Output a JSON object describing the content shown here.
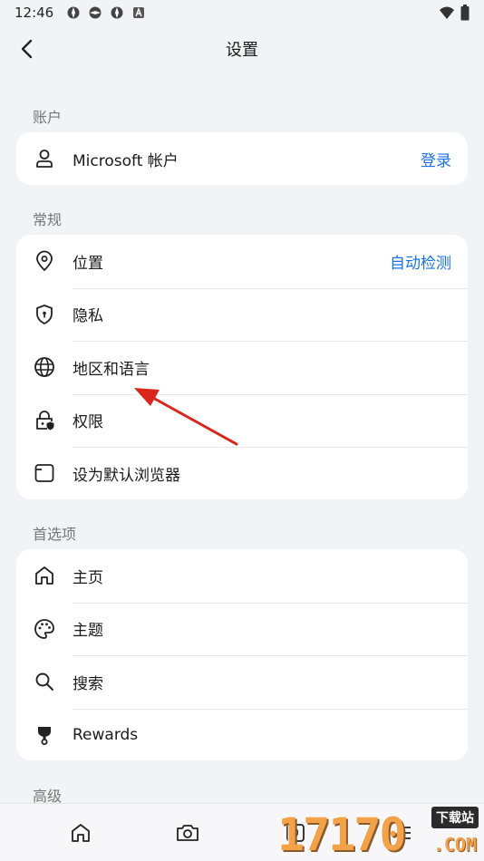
{
  "status_bar": {
    "time": "12:46"
  },
  "header": {
    "title": "设置"
  },
  "sections": {
    "account": {
      "label": "账户",
      "items": [
        {
          "label": "Microsoft 帐户",
          "action": "登录",
          "icon": "person-icon"
        }
      ]
    },
    "general": {
      "label": "常规",
      "items": [
        {
          "label": "位置",
          "action": "自动检测",
          "icon": "location-pin-icon"
        },
        {
          "label": "隐私",
          "icon": "shield-icon"
        },
        {
          "label": "地区和语言",
          "icon": "globe-icon"
        },
        {
          "label": "权限",
          "icon": "lock-shield-icon"
        },
        {
          "label": "设为默认浏览器",
          "icon": "browser-window-icon"
        }
      ]
    },
    "preferences": {
      "label": "首选项",
      "items": [
        {
          "label": "主页",
          "icon": "home-icon"
        },
        {
          "label": "主题",
          "icon": "palette-icon"
        },
        {
          "label": "搜索",
          "icon": "search-icon"
        },
        {
          "label": "Rewards",
          "icon": "trophy-icon"
        }
      ]
    },
    "advanced": {
      "label": "高级"
    }
  },
  "bottom_bar": {
    "tab_count": "0",
    "icons": [
      "home-icon",
      "camera-icon",
      "tabs-icon",
      "menu-icon"
    ]
  },
  "watermark": {
    "text": "17170",
    "badge": "下载站",
    "suffix": ".COM"
  },
  "colors": {
    "accent": "#1a73e8",
    "annotation_arrow": "#d9261c"
  }
}
